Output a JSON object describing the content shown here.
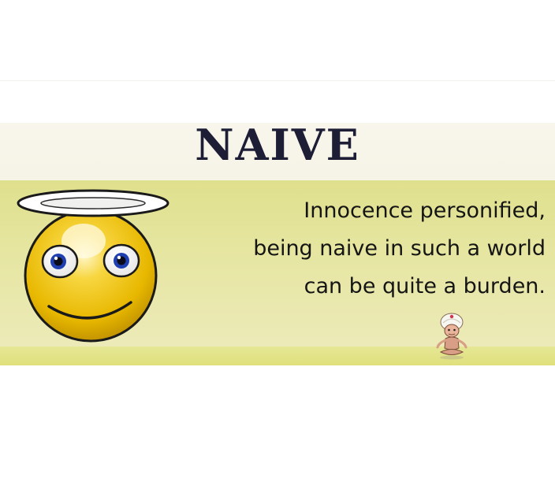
{
  "title": "NAIVE",
  "tagline": {
    "line1": "Innocence personified,",
    "line2": "being naive in such a world",
    "line3": "can be quite a burden."
  },
  "illustrations": {
    "left": "angel-smiley-with-halo",
    "right": "meditating-guru-with-turban"
  },
  "colors": {
    "panel": "#e3e497",
    "title": "#1d1d36",
    "smiley": "#f2c400"
  }
}
